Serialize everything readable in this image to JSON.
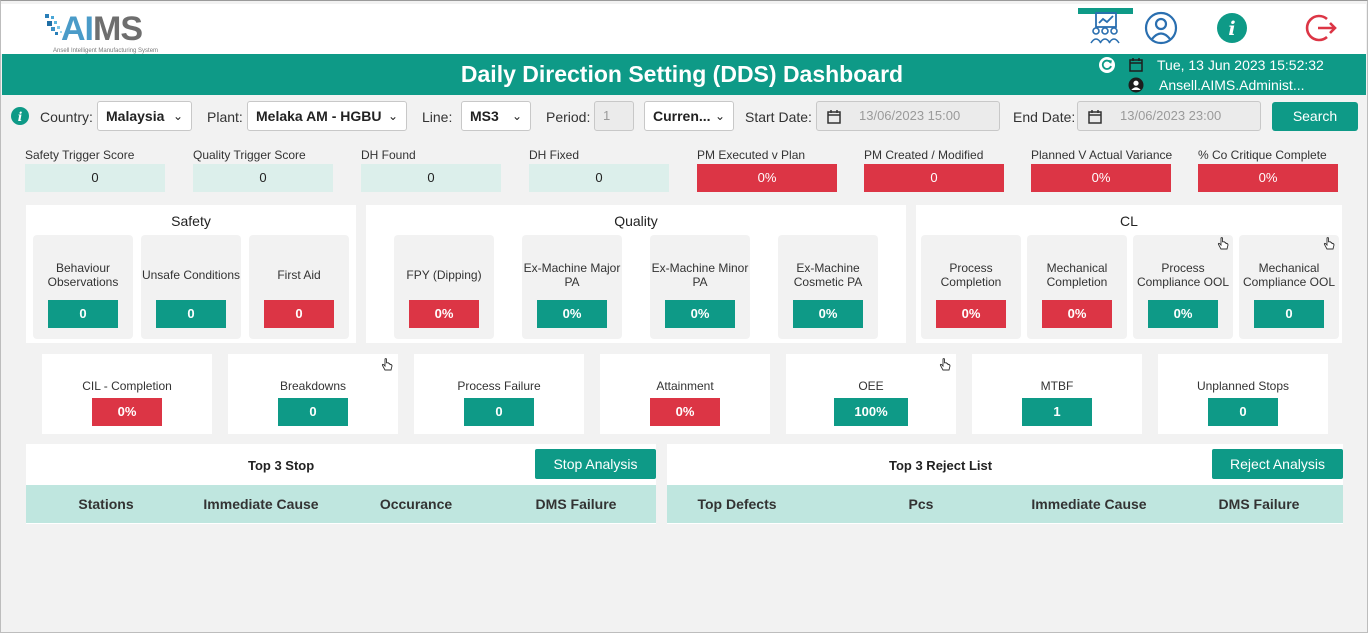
{
  "app": {
    "logo_text_ai": "AI",
    "logo_text_ms": "MS",
    "logo_subtitle": "Ansell Intelligent Manufacturing System"
  },
  "header": {
    "title": "Daily Direction Setting (DDS) Dashboard",
    "datetime": "Tue, 13 Jun 2023 15:52:32",
    "user": "Ansell.AIMS.Administ..."
  },
  "nav": {
    "icons": [
      "dashboard-team-icon",
      "user-profile-icon",
      "info-icon",
      "logout-icon"
    ]
  },
  "filters": {
    "country_label": "Country:",
    "country_value": "Malaysia",
    "plant_label": "Plant:",
    "plant_value": "Melaka AM - HGBU",
    "line_label": "Line:",
    "line_value": "MS3",
    "period_label": "Period:",
    "period_value": "1",
    "current_value": "Curren...",
    "start_label": "Start Date:",
    "start_value": "13/06/2023 15:00",
    "end_label": "End Date:",
    "end_value": "13/06/2023 23:00",
    "search_label": "Search"
  },
  "scores": [
    {
      "label": "Safety Trigger Score",
      "value": "0",
      "status": "neutral"
    },
    {
      "label": "Quality Trigger Score",
      "value": "0",
      "status": "neutral"
    },
    {
      "label": "DH Found",
      "value": "0",
      "status": "neutral"
    },
    {
      "label": "DH Fixed",
      "value": "0",
      "status": "neutral"
    },
    {
      "label": "PM Executed v Plan",
      "value": "0%",
      "status": "red"
    },
    {
      "label": "PM Created / Modified",
      "value": "0",
      "status": "red"
    },
    {
      "label": "Planned V Actual Variance",
      "value": "0%",
      "status": "red"
    },
    {
      "label": "% Co Critique Complete",
      "value": "0%",
      "status": "red"
    }
  ],
  "safety": {
    "title": "Safety",
    "cards": [
      {
        "label": "Behaviour Observations",
        "value": "0",
        "status": "green"
      },
      {
        "label": "Unsafe Conditions",
        "value": "0",
        "status": "green"
      },
      {
        "label": "First Aid",
        "value": "0",
        "status": "red"
      }
    ]
  },
  "quality": {
    "title": "Quality",
    "cards": [
      {
        "label": "FPY (Dipping)",
        "value": "0%",
        "status": "red"
      },
      {
        "label": "Ex-Machine Major PA",
        "value": "0%",
        "status": "green"
      },
      {
        "label": "Ex-Machine Minor PA",
        "value": "0%",
        "status": "green"
      },
      {
        "label": "Ex-Machine Cosmetic PA",
        "value": "0%",
        "status": "green"
      }
    ]
  },
  "cl": {
    "title": "CL",
    "cards": [
      {
        "label": "Process Completion",
        "value": "0%",
        "status": "red"
      },
      {
        "label": "Mechanical Completion",
        "value": "0%",
        "status": "red"
      },
      {
        "label": "Process Compliance OOL",
        "value": "0%",
        "status": "green"
      },
      {
        "label": "Mechanical Compliance OOL",
        "value": "0",
        "status": "green"
      }
    ]
  },
  "kpis": [
    {
      "label": "CIL - Completion",
      "value": "0%",
      "status": "red"
    },
    {
      "label": "Breakdowns",
      "value": "0",
      "status": "green"
    },
    {
      "label": "Process Failure",
      "value": "0",
      "status": "green"
    },
    {
      "label": "Attainment",
      "value": "0%",
      "status": "red"
    },
    {
      "label": "OEE",
      "value": "100%",
      "status": "green"
    },
    {
      "label": "MTBF",
      "value": "1",
      "status": "green"
    },
    {
      "label": "Unplanned Stops",
      "value": "0",
      "status": "green"
    }
  ],
  "top_stop": {
    "title": "Top 3 Stop",
    "button": "Stop Analysis",
    "columns": [
      "Stations",
      "Immediate Cause",
      "Occurance",
      "DMS Failure"
    ]
  },
  "top_reject": {
    "title": "Top 3 Reject List",
    "button": "Reject Analysis",
    "columns": [
      "Top Defects",
      "Pcs",
      "Immediate Cause",
      "DMS Failure"
    ]
  },
  "colors": {
    "accent": "#0e9a87",
    "danger": "#dc3545",
    "neutral_box": "#dcefeb",
    "table_header": "#bfe6df"
  }
}
